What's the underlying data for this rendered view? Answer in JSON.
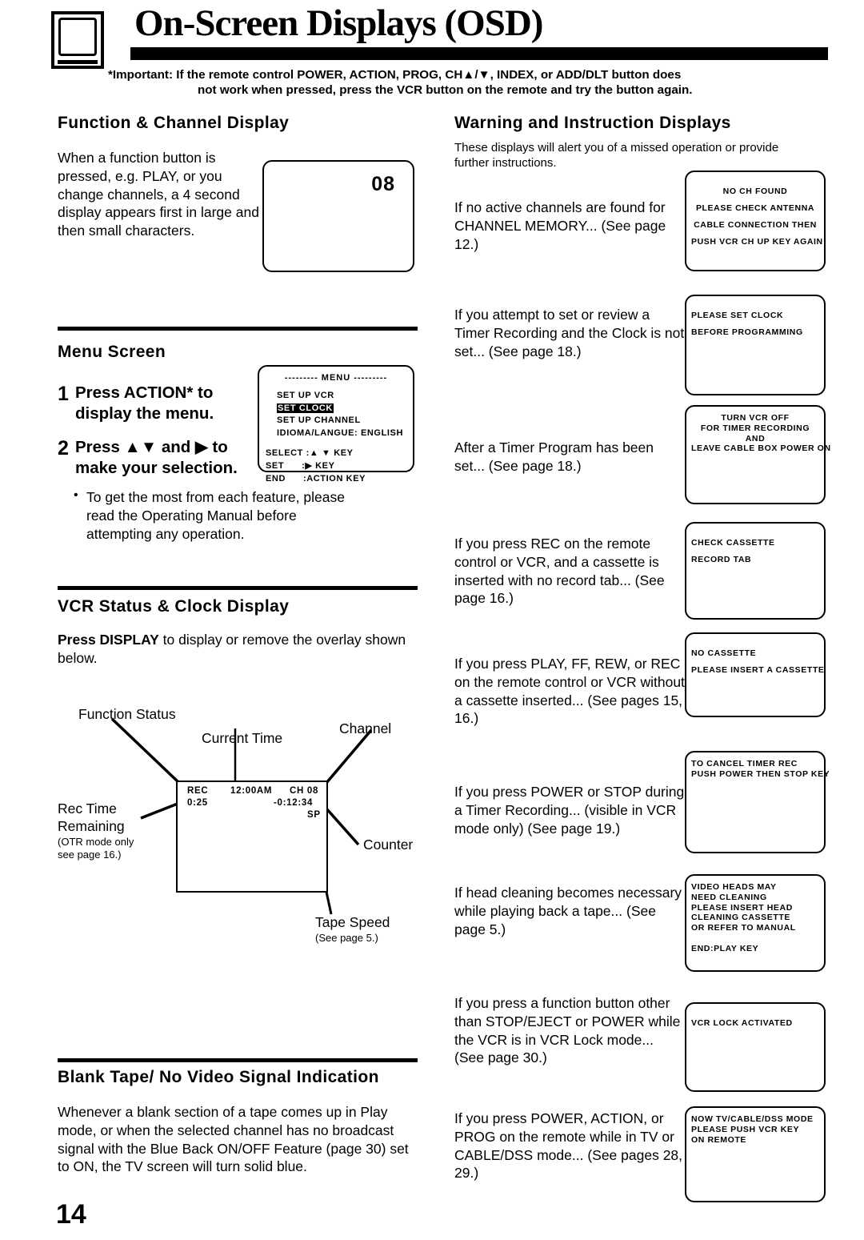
{
  "header": {
    "title": "On-Screen Displays (OSD)",
    "tv_icon": "television-icon",
    "important_label": "*Important:",
    "important_line1": "If the remote control POWER, ACTION, PROG, CH▲/▼, INDEX, or ADD/DLT button does",
    "important_line2": "not work when pressed, press the VCR button on the remote and try the button again."
  },
  "left": {
    "function_channel": {
      "heading": "Function & Channel Display",
      "body": "When a function button is pressed, e.g. PLAY, or you change channels, a 4 second display appears first in large and then small characters.",
      "osd_value": "08"
    },
    "menu_screen": {
      "heading": "Menu Screen",
      "step1_num": "1",
      "step1_text": "Press ACTION* to display the menu.",
      "step2_num": "2",
      "step2_text": "Press ▲▼ and ▶ to make your selection.",
      "bullet_marker": "•",
      "bullet_text": "To get the most from each feature, please read the Operating Manual before attempting any operation.",
      "osd": {
        "title": "--------- MENU ---------",
        "items": [
          "SET UP VCR",
          "SET CLOCK",
          "SET UP CHANNEL",
          "IDIOMA/LANGUE: ENGLISH"
        ],
        "highlighted_item": "SET CLOCK",
        "keys": [
          "SELECT :▲ ▼ KEY",
          "SET      :▶ KEY",
          "END      :ACTION KEY"
        ]
      }
    },
    "vcr_status": {
      "heading": "VCR Status & Clock Display",
      "body_bold": "Press DISPLAY",
      "body_rest": " to display or remove the overlay shown below.",
      "diagram": {
        "label_function_status": "Function Status",
        "label_current_time": "Current Time",
        "label_channel": "Channel",
        "label_rec_time_line1": "Rec Time",
        "label_rec_time_line2": "Remaining",
        "label_rec_time_note1": "(OTR mode only",
        "label_rec_time_note2": "see page 16.)",
        "label_counter": "Counter",
        "label_tape_speed": "Tape Speed",
        "label_tape_speed_note": "(See page 5.)",
        "osd_function": "REC",
        "osd_time": "12:00AM",
        "osd_channel": "CH 08",
        "osd_rec_remaining": "0:25",
        "osd_counter": "-0:12:34",
        "osd_speed": "SP"
      }
    },
    "blank_tape": {
      "heading": "Blank Tape/ No Video Signal Indication",
      "body": "Whenever a blank section of a tape comes up in Play mode, or when the selected channel has no broadcast signal with the Blue Back ON/OFF Feature (page 30) set to ON, the TV screen will turn solid blue."
    },
    "page_number": "14"
  },
  "right": {
    "heading": "Warning and Instruction Displays",
    "subheading": "These displays will alert you of a missed operation or provide further instructions.",
    "items": [
      {
        "text": "If no active channels are found for CHANNEL MEMORY... (See page 12.)",
        "osd_lines": [
          "NO CH FOUND",
          "PLEASE CHECK ANTENNA",
          "CABLE CONNECTION THEN",
          "PUSH VCR CH UP KEY AGAIN"
        ],
        "osd_align": "center",
        "osd_spacing": "wide"
      },
      {
        "text": "If you attempt to set or review a Timer Recording and the Clock is not set... (See page 18.)",
        "osd_lines": [
          "PLEASE SET CLOCK",
          "BEFORE PROGRAMMING"
        ],
        "osd_align": "left",
        "osd_spacing": "wide"
      },
      {
        "text": "After a Timer Program has been set... (See page 18.)",
        "osd_lines": [
          "TURN VCR OFF",
          "FOR TIMER RECORDING",
          "AND",
          "LEAVE CABLE BOX POWER ON"
        ],
        "osd_align": "center",
        "osd_spacing": "tight"
      },
      {
        "text": "If you press REC on the remote control or VCR, and a cassette is inserted with no record tab... (See page 16.)",
        "osd_lines": [
          "CHECK CASSETTE",
          "RECORD TAB"
        ],
        "osd_align": "left",
        "osd_spacing": "wide"
      },
      {
        "text": "If you press PLAY, FF, REW, or REC on the remote control or VCR without a cassette inserted... (See pages 15, 16.)",
        "osd_lines": [
          "NO CASSETTE",
          "PLEASE INSERT A CASSETTE"
        ],
        "osd_align": "left",
        "osd_spacing": "wide"
      },
      {
        "text": "If you press POWER or STOP during a Timer Recording... (visible in VCR mode only) (See page 19.)",
        "osd_lines": [
          "TO CANCEL TIMER REC",
          "PUSH POWER THEN STOP KEY"
        ],
        "osd_align": "left",
        "osd_spacing": "tight"
      },
      {
        "text": "If head cleaning becomes necessary while playing back a tape... (See page 5.)",
        "osd_lines": [
          "VIDEO HEADS MAY",
          "NEED CLEANING",
          "PLEASE INSERT HEAD",
          "CLEANING CASSETTE",
          "OR REFER TO MANUAL",
          "",
          "END:PLAY KEY"
        ],
        "osd_align": "left",
        "osd_spacing": "tight"
      },
      {
        "text": "If you press a function button other than STOP/EJECT or POWER while the VCR is in VCR Lock mode... (See page 30.)",
        "osd_lines": [
          "VCR LOCK ACTIVATED"
        ],
        "osd_align": "left",
        "osd_spacing": "wide"
      },
      {
        "text": "If you press POWER, ACTION, or PROG on the remote while in TV or CABLE/DSS mode... (See pages 28, 29.)",
        "osd_lines": [
          "NOW TV/CABLE/DSS MODE",
          "PLEASE PUSH VCR KEY",
          "ON REMOTE"
        ],
        "osd_align": "left",
        "osd_spacing": "tight"
      }
    ]
  }
}
